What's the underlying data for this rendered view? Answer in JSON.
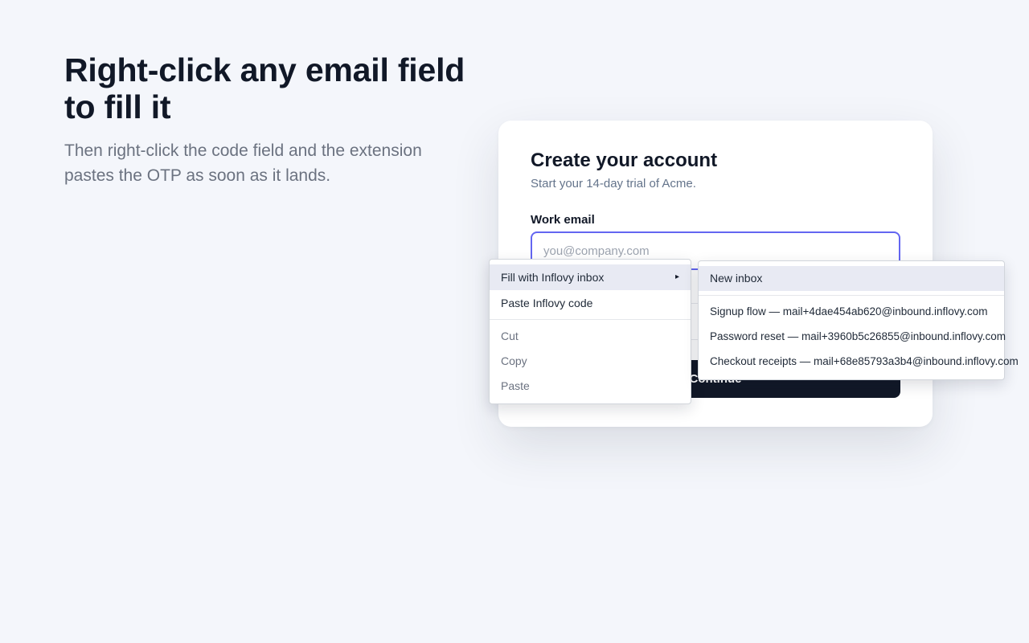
{
  "hero": {
    "title": "Right-click any email field to fill it",
    "subtitle": "Then right-click the code field and the extension pastes the OTP as soon as it lands."
  },
  "card": {
    "title": "Create your account",
    "subtitle": "Start your 14-day trial of Acme.",
    "email_label": "Work email",
    "email_placeholder": "you@company.com",
    "email_value": "",
    "continue_label": "Continue"
  },
  "context_menu": {
    "items": [
      {
        "label": "Fill with Inflovy inbox",
        "has_submenu": true,
        "arrow": "▸"
      },
      {
        "label": "Paste Inflovy code"
      }
    ],
    "edit_items": [
      {
        "label": "Cut"
      },
      {
        "label": "Copy"
      },
      {
        "label": "Paste"
      }
    ]
  },
  "submenu": {
    "new_inbox": "New inbox",
    "inboxes": [
      {
        "label": "Signup flow — mail+4dae454ab620@inbound.inflovy.com"
      },
      {
        "label": "Password reset — mail+3960b5c26855@inbound.inflovy.com"
      },
      {
        "label": "Checkout receipts — mail+68e85793a3b4@inbound.inflovy.com"
      }
    ]
  },
  "colors": {
    "accent": "#6366f1",
    "button": "#111827",
    "menu_highlight": "#e8eaf3"
  }
}
